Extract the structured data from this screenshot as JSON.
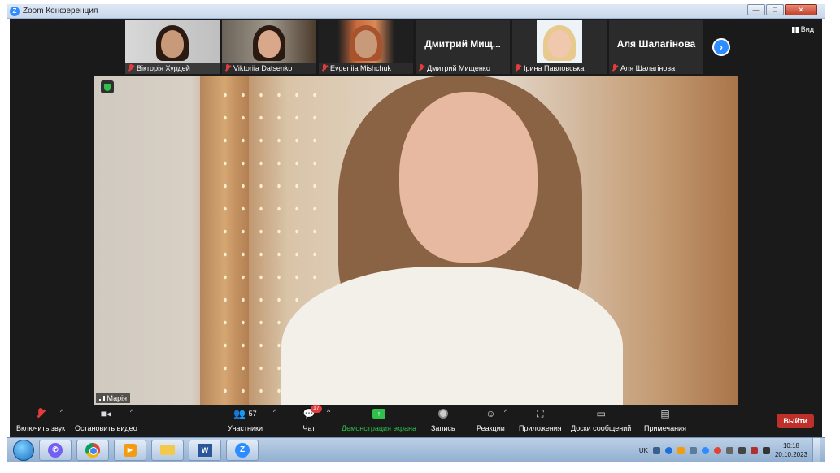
{
  "window": {
    "title": "Zoom Конференция",
    "app_icon": "Z",
    "controls": {
      "minimize": "—",
      "maximize": "□",
      "close": "✕"
    }
  },
  "view_button": "Вид",
  "participants_strip": [
    {
      "name": "Вікторія Хурдей",
      "has_video": true
    },
    {
      "name": "Viktoriia Datsenko",
      "has_video": true
    },
    {
      "name": "Evgeniia Mishchuk",
      "has_video": true
    },
    {
      "name": "Дмитрий Мищенко",
      "display_title": "Дмитрий  Мищ...",
      "has_video": false
    },
    {
      "name": "Ірина Павловська",
      "has_video": true
    },
    {
      "name": "Аля Шалагінова",
      "display_title": "Аля Шалагінова",
      "has_video": false
    }
  ],
  "next_page_arrow": "›",
  "active_speaker": {
    "name": "Марія"
  },
  "toolbar": {
    "unmute": "Включить звук",
    "stop_video": "Остановить видео",
    "participants": "Участники",
    "participants_count": "57",
    "chat": "Чат",
    "chat_badge": "17",
    "share_screen": "Демонстрация экрана",
    "record": "Запись",
    "reactions": "Реакции",
    "apps": "Приложения",
    "whiteboards": "Доски сообщений",
    "notes": "Примечания",
    "leave": "Выйти",
    "caret": "^"
  },
  "taskbar": {
    "word_label": "W",
    "zoom_label": "Z",
    "language": "UK",
    "time": "10:18",
    "date": "20.10.2023"
  },
  "colors": {
    "zoom_blue": "#2d8cff",
    "leave_red": "#c0302a",
    "share_green": "#2fbf4c",
    "toolbar_bg": "#1a1a1a"
  }
}
